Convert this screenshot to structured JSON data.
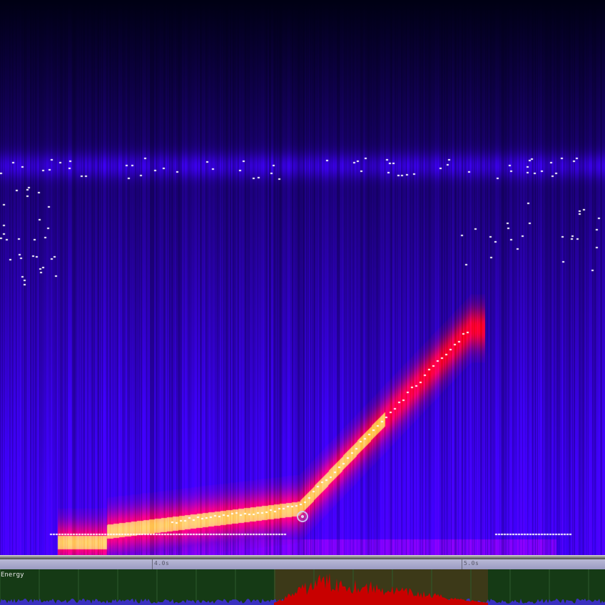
{
  "timeline": {
    "markers": [
      {
        "label": "4.0s",
        "time": 4.0
      },
      {
        "label": "5.0s",
        "time": 5.0
      }
    ]
  },
  "energy_panel": {
    "label": "Energy"
  },
  "colors": {
    "spectrogram_low": "#000010",
    "spectrogram_mid": "#3a00ff",
    "spectrogram_high": "#c00000",
    "spectrogram_peak": "#ffe066",
    "pitch_marks": "#ffffff",
    "energy_background": "#153a15",
    "energy_selection": "#4a3a1a",
    "energy_trace": "#c80000",
    "energy_base": "#3a30c0"
  }
}
